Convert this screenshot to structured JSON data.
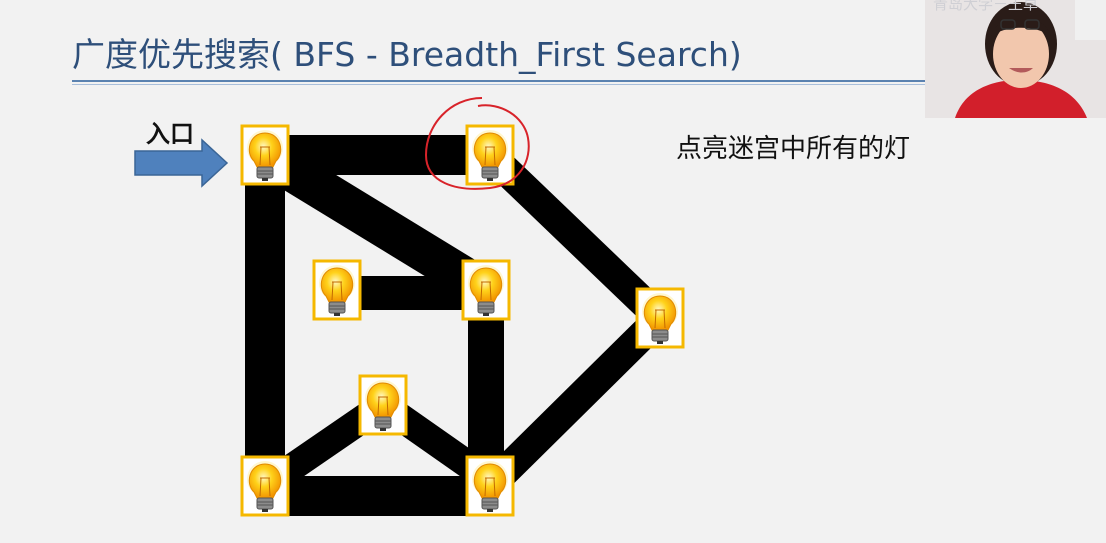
{
  "slide": {
    "title": "广度优先搜索( BFS  -  Breadth_First Search)",
    "subtitle": "点亮迷宫中所有的灯",
    "entry_label": "入口"
  },
  "webcam": {
    "overlay_text": "青岛大学－王卓"
  },
  "colors": {
    "title": "#2e4f7a",
    "corridor": "#000000",
    "arrow": "#4f81bd",
    "bulb_frame": "#f5b800",
    "bulb_glass": "#ffd21a",
    "highlight_circle": "#d8232a"
  },
  "diagram": {
    "nodes": [
      {
        "id": "n1",
        "icon": "lightbulb-icon",
        "entry": true
      },
      {
        "id": "n2",
        "icon": "lightbulb-icon",
        "highlighted": true
      },
      {
        "id": "n3",
        "icon": "lightbulb-icon"
      },
      {
        "id": "n4",
        "icon": "lightbulb-icon"
      },
      {
        "id": "n5",
        "icon": "lightbulb-icon"
      },
      {
        "id": "n6",
        "icon": "lightbulb-icon"
      },
      {
        "id": "n7",
        "icon": "lightbulb-icon"
      },
      {
        "id": "n8",
        "icon": "lightbulb-icon"
      }
    ],
    "edges": [
      [
        "n1",
        "n2"
      ],
      [
        "n1",
        "n7"
      ],
      [
        "n1",
        "n4"
      ],
      [
        "n3",
        "n4"
      ],
      [
        "n2",
        "n5"
      ],
      [
        "n4",
        "n8"
      ],
      [
        "n5",
        "n8"
      ],
      [
        "n7",
        "n6"
      ],
      [
        "n6",
        "n8"
      ],
      [
        "n7",
        "n8"
      ]
    ]
  }
}
